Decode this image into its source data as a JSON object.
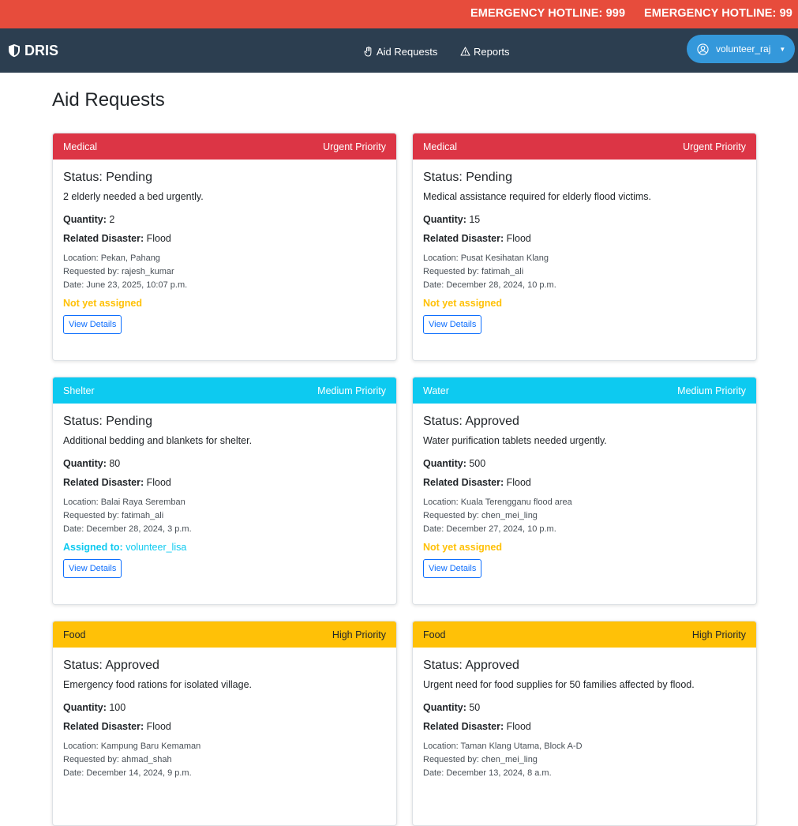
{
  "ticker": {
    "text": "EMERGENCY HOTLINE: 999",
    "text_repeat": "EMERGENCY HOTLINE: 99"
  },
  "navbar": {
    "brand": "DRIS",
    "links": [
      {
        "label": "Aid Requests",
        "icon": "hand-icon"
      },
      {
        "label": "Reports",
        "icon": "warning-icon"
      }
    ],
    "user": {
      "label": "volunteer_raj",
      "icon": "user-circle-icon"
    }
  },
  "page": {
    "title": "Aid Requests"
  },
  "colors": {
    "urgent": "#dc3545",
    "medium": "#0dcaf0",
    "high": "#ffc107",
    "unassigned": "#ffc107",
    "assigned": "#0dcaf0"
  },
  "labels": {
    "quantity": "Quantity:",
    "disaster": "Related Disaster:",
    "view": "View Details"
  },
  "cards": [
    {
      "type": "Medical",
      "priority": "Urgent Priority",
      "level": "urgent",
      "status": "Status: Pending",
      "description": "2 elderly needed a bed urgently.",
      "quantity": "2",
      "disaster": "Flood",
      "location": "Location: Pekan, Pahang",
      "requested_by": "Requested by: rajesh_kumar",
      "date": "Date: June 23, 2025, 10:07 p.m.",
      "assigned": false,
      "assign_label": "Not yet assigned",
      "assignee": ""
    },
    {
      "type": "Medical",
      "priority": "Urgent Priority",
      "level": "urgent",
      "status": "Status: Pending",
      "description": "Medical assistance required for elderly flood victims.",
      "quantity": "15",
      "disaster": "Flood",
      "location": "Location: Pusat Kesihatan Klang",
      "requested_by": "Requested by: fatimah_ali",
      "date": "Date: December 28, 2024, 10 p.m.",
      "assigned": false,
      "assign_label": "Not yet assigned",
      "assignee": ""
    },
    {
      "type": "Shelter",
      "priority": "Medium Priority",
      "level": "medium",
      "status": "Status: Pending",
      "description": "Additional bedding and blankets for shelter.",
      "quantity": "80",
      "disaster": "Flood",
      "location": "Location: Balai Raya Seremban",
      "requested_by": "Requested by: fatimah_ali",
      "date": "Date: December 28, 2024, 3 p.m.",
      "assigned": true,
      "assign_label": "Assigned to:",
      "assignee": "volunteer_lisa"
    },
    {
      "type": "Water",
      "priority": "Medium Priority",
      "level": "medium",
      "status": "Status: Approved",
      "description": "Water purification tablets needed urgently.",
      "quantity": "500",
      "disaster": "Flood",
      "location": "Location: Kuala Terengganu flood area",
      "requested_by": "Requested by: chen_mei_ling",
      "date": "Date: December 27, 2024, 10 p.m.",
      "assigned": false,
      "assign_label": "Not yet assigned",
      "assignee": ""
    },
    {
      "type": "Food",
      "priority": "High Priority",
      "level": "high",
      "status": "Status: Approved",
      "description": "Emergency food rations for isolated village.",
      "quantity": "100",
      "disaster": "Flood",
      "location": "Location: Kampung Baru Kemaman",
      "requested_by": "Requested by: ahmad_shah",
      "date": "Date: December 14, 2024, 9 p.m.",
      "assigned": false,
      "assign_label": "",
      "assignee": ""
    },
    {
      "type": "Food",
      "priority": "High Priority",
      "level": "high",
      "status": "Status: Approved",
      "description": "Urgent need for food supplies for 50 families affected by flood.",
      "quantity": "50",
      "disaster": "Flood",
      "location": "Location: Taman Klang Utama, Block A-D",
      "requested_by": "Requested by: chen_mei_ling",
      "date": "Date: December 13, 2024, 8 a.m.",
      "assigned": false,
      "assign_label": "",
      "assignee": ""
    }
  ]
}
